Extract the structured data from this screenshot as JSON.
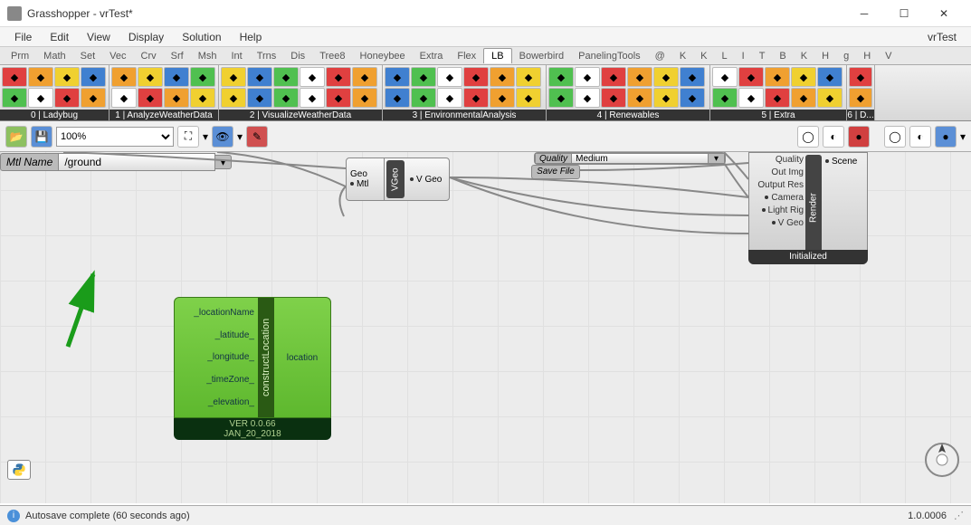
{
  "titlebar": {
    "title": "Grasshopper - vrTest*"
  },
  "menubar": {
    "items": [
      "File",
      "Edit",
      "View",
      "Display",
      "Solution",
      "Help"
    ],
    "right": "vrTest"
  },
  "tabs": {
    "items": [
      "Prm",
      "Math",
      "Set",
      "Vec",
      "Crv",
      "Srf",
      "Msh",
      "Int",
      "Trns",
      "Dis",
      "Tree8",
      "Honeybee",
      "Extra",
      "Flex",
      "LB",
      "Bowerbird",
      "PanelingTools",
      "@",
      "K",
      "K",
      "L",
      "I",
      "T",
      "B",
      "K",
      "H",
      "g",
      "H",
      "V"
    ],
    "active": "LB"
  },
  "ribbon": {
    "groups": [
      {
        "label": "0 | Ladybug",
        "cols": 4
      },
      {
        "label": "1 | AnalyzeWeatherData",
        "cols": 4
      },
      {
        "label": "2 | VisualizeWeatherData",
        "cols": 6
      },
      {
        "label": "3 | EnvironmentalAnalysis",
        "cols": 6
      },
      {
        "label": "4 | Renewables",
        "cols": 6
      },
      {
        "label": "5 | Extra",
        "cols": 5
      },
      {
        "label": "6 | D...",
        "cols": 1
      }
    ]
  },
  "toolbar2": {
    "zoom": "100%"
  },
  "canvas": {
    "vgeo": {
      "inputs": [
        "Geo",
        "Mtl"
      ],
      "name": "VGeo",
      "output": "V Geo"
    },
    "mtlname": {
      "label": "Mtl Name",
      "value": "/ground"
    },
    "quality": {
      "label": "Quality",
      "value": "Medium"
    },
    "savefile": {
      "label": "Save File"
    },
    "render": {
      "inputs": [
        "Quality",
        "Out Img",
        "Output Res",
        "Camera",
        "Light Rig",
        "V Geo"
      ],
      "name": "Render",
      "output": "Scene",
      "footer": "Initialized"
    },
    "location": {
      "inputs": [
        "_locationName",
        "_latitude_",
        "_longitude_",
        "_timeZone_",
        "_elevation_"
      ],
      "name": "constructLocation",
      "output": "location",
      "ver": "VER 0.0.66",
      "date": "JAN_20_2018"
    }
  },
  "status": {
    "msg": "Autosave complete (60 seconds ago)",
    "ver": "1.0.0006"
  }
}
